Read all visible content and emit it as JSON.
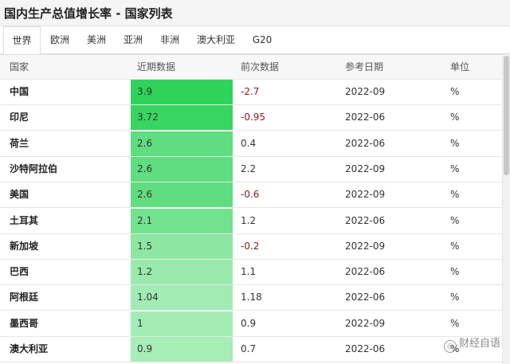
{
  "header": {
    "title": "国内生产总值增长率 - 国家列表"
  },
  "tabs": [
    {
      "label": "世界",
      "active": true
    },
    {
      "label": "欧洲",
      "active": false
    },
    {
      "label": "美洲",
      "active": false
    },
    {
      "label": "亚洲",
      "active": false
    },
    {
      "label": "非洲",
      "active": false
    },
    {
      "label": "澳大利亚",
      "active": false
    },
    {
      "label": "G20",
      "active": false
    }
  ],
  "table": {
    "columns": [
      "国家",
      "近期数据",
      "前次数据",
      "参考日期",
      "单位"
    ],
    "rows": [
      {
        "country": "中国",
        "recent": "3.9",
        "previous": "-2.7",
        "date": "2022-09",
        "unit": "%",
        "heat": 1.0
      },
      {
        "country": "印尼",
        "recent": "3.72",
        "previous": "-0.95",
        "date": "2022-06",
        "unit": "%",
        "heat": 0.95
      },
      {
        "country": "荷兰",
        "recent": "2.6",
        "previous": "0.4",
        "date": "2022-06",
        "unit": "%",
        "heat": 0.72
      },
      {
        "country": "沙特阿拉伯",
        "recent": "2.6",
        "previous": "2.2",
        "date": "2022-09",
        "unit": "%",
        "heat": 0.72
      },
      {
        "country": "美国",
        "recent": "2.6",
        "previous": "-0.6",
        "date": "2022-09",
        "unit": "%",
        "heat": 0.72
      },
      {
        "country": "土耳其",
        "recent": "2.1",
        "previous": "1.2",
        "date": "2022-06",
        "unit": "%",
        "heat": 0.6
      },
      {
        "country": "新加坡",
        "recent": "1.5",
        "previous": "-0.2",
        "date": "2022-09",
        "unit": "%",
        "heat": 0.45
      },
      {
        "country": "巴西",
        "recent": "1.2",
        "previous": "1.1",
        "date": "2022-06",
        "unit": "%",
        "heat": 0.37
      },
      {
        "country": "阿根廷",
        "recent": "1.04",
        "previous": "1.18",
        "date": "2022-06",
        "unit": "%",
        "heat": 0.33
      },
      {
        "country": "墨西哥",
        "recent": "1",
        "previous": "0.9",
        "date": "2022-09",
        "unit": "%",
        "heat": 0.32
      },
      {
        "country": "澳大利亚",
        "recent": "0.9",
        "previous": "0.7",
        "date": "2022-06",
        "unit": "%",
        "heat": 0.3
      }
    ]
  },
  "colors": {
    "heat_strong": "#2fd35a",
    "heat_weak": "#a6edb6",
    "negative": "#8b1a1a"
  },
  "watermark": {
    "icon": "weibo-icon",
    "text": "财经自语"
  }
}
